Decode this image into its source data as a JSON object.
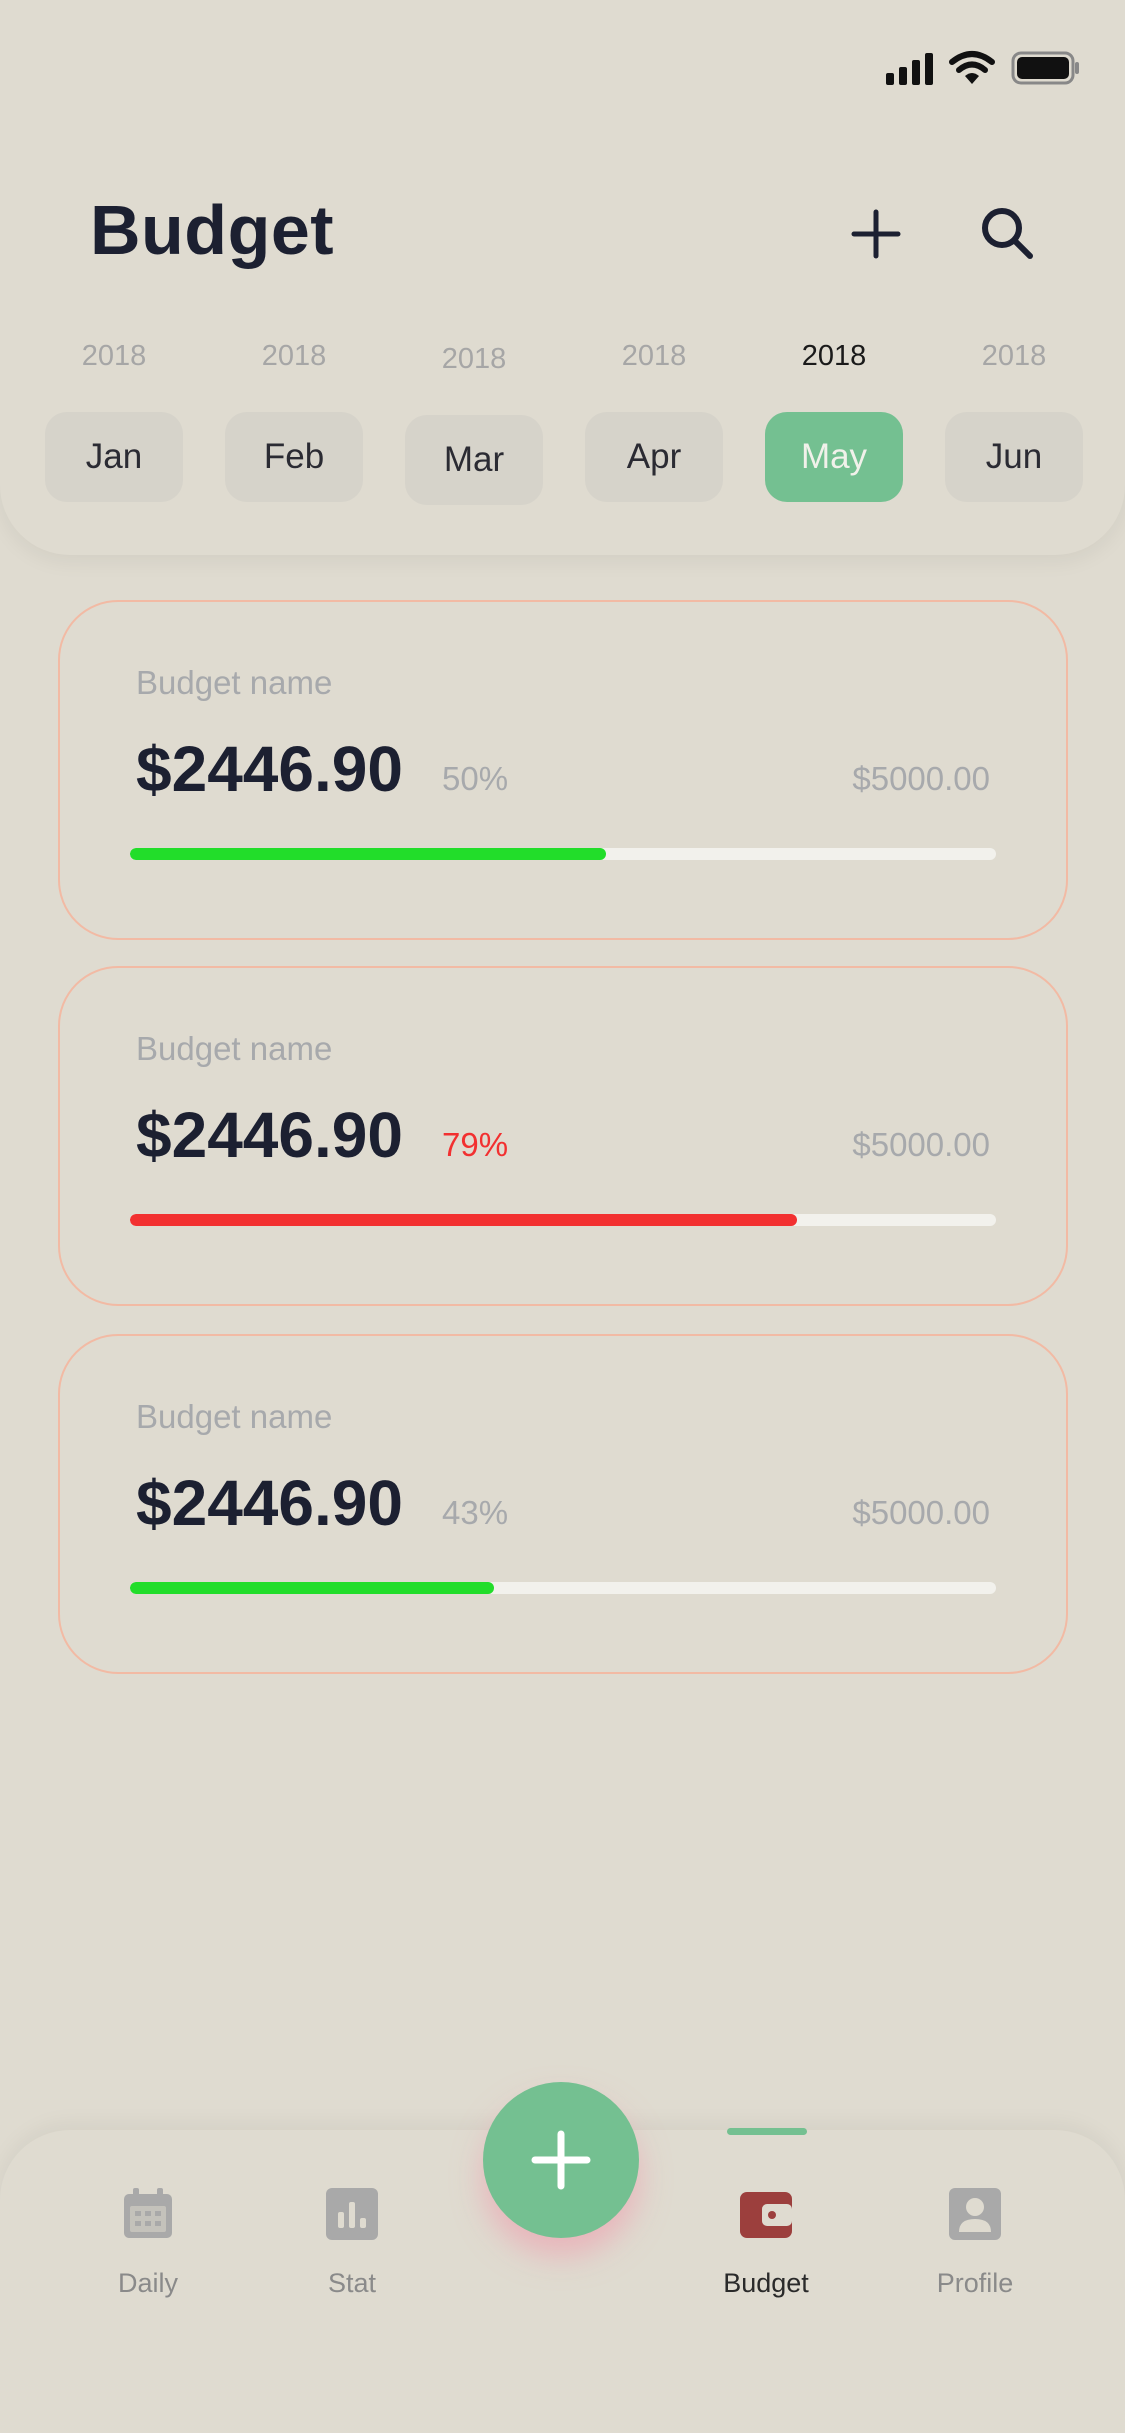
{
  "header": {
    "title": "Budget"
  },
  "months": [
    {
      "year": "2018",
      "label": "Jan",
      "active": false
    },
    {
      "year": "2018",
      "label": "Feb",
      "active": false
    },
    {
      "year": "2018",
      "label": "Mar",
      "active": false
    },
    {
      "year": "2018",
      "label": "Apr",
      "active": false
    },
    {
      "year": "2018",
      "label": "May",
      "active": true
    },
    {
      "year": "2018",
      "label": "Jun",
      "active": false
    }
  ],
  "budgets": [
    {
      "name": "Budget name",
      "amount": "$2446.90",
      "percent": "50%",
      "limit": "$5000.00",
      "progress": 0.55,
      "status": "ok"
    },
    {
      "name": "Budget name",
      "amount": "$2446.90",
      "percent": "79%",
      "limit": "$5000.00",
      "progress": 0.77,
      "status": "over"
    },
    {
      "name": "Budget name",
      "amount": "$2446.90",
      "percent": "43%",
      "limit": "$5000.00",
      "progress": 0.42,
      "status": "ok"
    }
  ],
  "nav": {
    "items": [
      {
        "label": "Daily",
        "icon": "calendar-icon",
        "active": false
      },
      {
        "label": "Stat",
        "icon": "bar-chart-icon",
        "active": false
      },
      {
        "label": "Budget",
        "icon": "wallet-icon",
        "active": true
      },
      {
        "label": "Profile",
        "icon": "profile-icon",
        "active": false
      }
    ],
    "fab_icon": "plus-icon"
  },
  "colors": {
    "background": "#dfdbd0",
    "accent": "#74c091",
    "progress_ok": "#22dd2a",
    "progress_over": "#f23030",
    "card_border": "#f2baa4",
    "wallet": "#9c3f3d",
    "text_dark": "#1c2031"
  }
}
